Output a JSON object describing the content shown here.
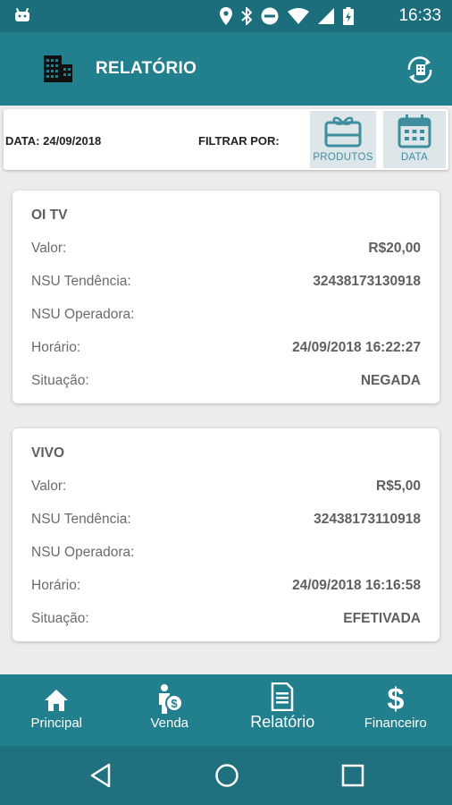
{
  "status_bar": {
    "time": "16:33",
    "icons": [
      "android-icon",
      "location-icon",
      "bluetooth-icon",
      "dnd-icon",
      "wifi-icon",
      "signal-icon",
      "battery-icon"
    ]
  },
  "app_bar": {
    "title": "RELATÓRIO",
    "left_icon": "building-icon",
    "right_icon": "sync-icon"
  },
  "filter_bar": {
    "date_label": "DATA: 24/09/2018",
    "filter_label": "FILTRAR POR:",
    "buttons": [
      {
        "label": "PRODUTOS",
        "icon": "gift-card-icon"
      },
      {
        "label": "DATA",
        "icon": "calendar-icon"
      }
    ]
  },
  "cards": [
    {
      "title": "OI TV",
      "rows": [
        {
          "label": "Valor:",
          "value": "R$20,00"
        },
        {
          "label": "NSU Tendência:",
          "value": "32438173130918"
        },
        {
          "label": "NSU Operadora:",
          "value": ""
        },
        {
          "label": "Horário:",
          "value": "24/09/2018 16:22:27"
        },
        {
          "label": "Situação:",
          "value": "NEGADA"
        }
      ]
    },
    {
      "title": "VIVO",
      "rows": [
        {
          "label": "Valor:",
          "value": "R$5,00"
        },
        {
          "label": "NSU Tendência:",
          "value": "32438173110918"
        },
        {
          "label": "NSU Operadora:",
          "value": ""
        },
        {
          "label": "Horário:",
          "value": "24/09/2018 16:16:58"
        },
        {
          "label": "Situação:",
          "value": "EFETIVADA"
        }
      ]
    }
  ],
  "bottom_nav": {
    "items": [
      {
        "label": "Principal",
        "icon": "home-icon"
      },
      {
        "label": "Venda",
        "icon": "person-money-icon"
      },
      {
        "label": "Relatório",
        "icon": "document-icon",
        "active": true
      },
      {
        "label": "Financeiro",
        "icon": "dollar-icon"
      }
    ]
  },
  "system_nav": {
    "icons": [
      "back-icon",
      "home-circle-icon",
      "recents-icon"
    ]
  },
  "colors": {
    "primary": "#217f8e",
    "status_bar": "#1d6e7c",
    "filter_button_bg": "#dde6e9",
    "filter_button_text": "#3e8ea0"
  }
}
